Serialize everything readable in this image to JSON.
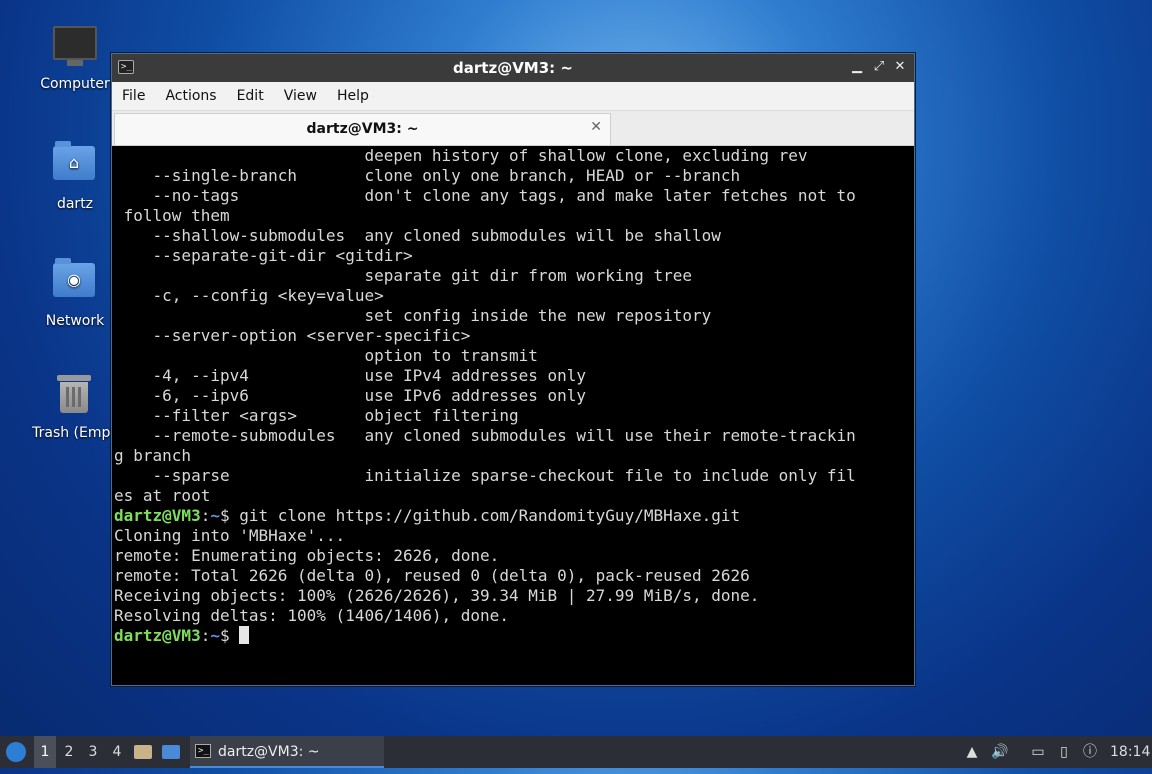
{
  "desktop": {
    "icons": [
      {
        "label": "Computer"
      },
      {
        "label": "dartz"
      },
      {
        "label": "Network"
      },
      {
        "label": "Trash (Empt"
      }
    ]
  },
  "window": {
    "title": "dartz@VM3: ~",
    "menu": [
      "File",
      "Actions",
      "Edit",
      "View",
      "Help"
    ],
    "tab_label": "dartz@VM3: ~"
  },
  "terminal": {
    "help_lines": [
      "                          deepen history of shallow clone, excluding rev",
      "    --single-branch       clone only one branch, HEAD or --branch",
      "    --no-tags             don't clone any tags, and make later fetches not to",
      " follow them",
      "    --shallow-submodules  any cloned submodules will be shallow",
      "    --separate-git-dir <gitdir>",
      "                          separate git dir from working tree",
      "    -c, --config <key=value>",
      "                          set config inside the new repository",
      "    --server-option <server-specific>",
      "                          option to transmit",
      "    -4, --ipv4            use IPv4 addresses only",
      "    -6, --ipv6            use IPv6 addresses only",
      "    --filter <args>       object filtering",
      "    --remote-submodules   any cloned submodules will use their remote-trackin",
      "g branch",
      "    --sparse              initialize sparse-checkout file to include only fil",
      "es at root",
      ""
    ],
    "prompt_user": "dartz@VM3",
    "prompt_colon": ":",
    "prompt_dir": "~",
    "prompt_sign": "$ ",
    "command": "git clone https://github.com/RandomityGuy/MBHaxe.git",
    "output_lines": [
      "Cloning into 'MBHaxe'...",
      "remote: Enumerating objects: 2626, done.",
      "remote: Total 2626 (delta 0), reused 0 (delta 0), pack-reused 2626",
      "Receiving objects: 100% (2626/2626), 39.34 MiB | 27.99 MiB/s, done.",
      "Resolving deltas: 100% (1406/1406), done."
    ]
  },
  "taskbar": {
    "workspaces": [
      "1",
      "2",
      "3",
      "4"
    ],
    "active_workspace": "1",
    "task_label": "dartz@VM3: ~",
    "clock": "18:14"
  }
}
